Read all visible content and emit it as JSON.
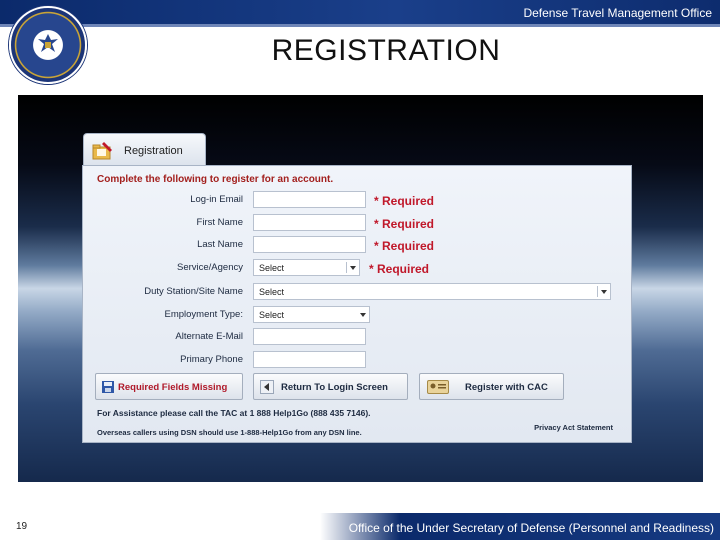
{
  "header": {
    "org_name": "Defense Travel Management Office",
    "seal_icon": "dod-seal-icon"
  },
  "page": {
    "title": "REGISTRATION",
    "slide_number": "19",
    "footer_org": "Office of the Under Secretary of Defense (Personnel and Readiness)"
  },
  "form": {
    "tab_label": "Registration",
    "tab_icon": "folder-pencil-icon",
    "instructions": "Complete the following to register for an account.",
    "fields": {
      "email": {
        "label": "Log-in Email",
        "required": "* Required"
      },
      "first_name": {
        "label": "First Name",
        "required": "* Required"
      },
      "last_name": {
        "label": "Last Name",
        "required": "* Required"
      },
      "service_agency": {
        "label": "Service/Agency",
        "value": "Select",
        "required": "* Required"
      },
      "duty_station": {
        "label": "Duty Station/Site Name",
        "value": "Select"
      },
      "employment_type": {
        "label": "Employment Type:",
        "value": "Select"
      },
      "alternate_email": {
        "label": "Alternate E-Mail"
      },
      "primary_phone": {
        "label": "Primary Phone"
      }
    },
    "buttons": {
      "missing": "Required Fields Missing",
      "return_login": "Return To Login Screen",
      "register_cac": "Register with CAC"
    },
    "assistance": "For Assistance please call the TAC at 1 888 Help1Go (888 435 7146).",
    "overseas": "Overseas callers using DSN should use 1-888-Help1Go from any DSN line.",
    "privacy": "Privacy Act Statement"
  },
  "colors": {
    "header_blue": "#0b2a6b",
    "required_red": "#c0182a",
    "instructions_red": "#a3201e"
  }
}
